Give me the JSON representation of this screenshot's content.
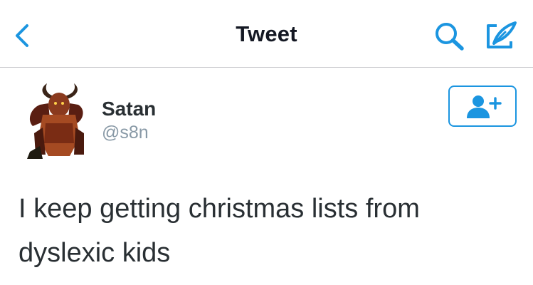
{
  "colors": {
    "accent": "#1b95e0",
    "text": "#292f33",
    "secondary": "#8899a6",
    "divider": "#c8c8cc"
  },
  "nav": {
    "title": "Tweet",
    "back_icon": "chevron-left-icon",
    "search_icon": "search-icon",
    "compose_icon": "compose-tweet-icon"
  },
  "tweet": {
    "author": {
      "display_name": "Satan",
      "username": "@s8n"
    },
    "follow_icon": "add-user-icon",
    "text": "I keep getting christmas lists from dyslexic kids"
  }
}
